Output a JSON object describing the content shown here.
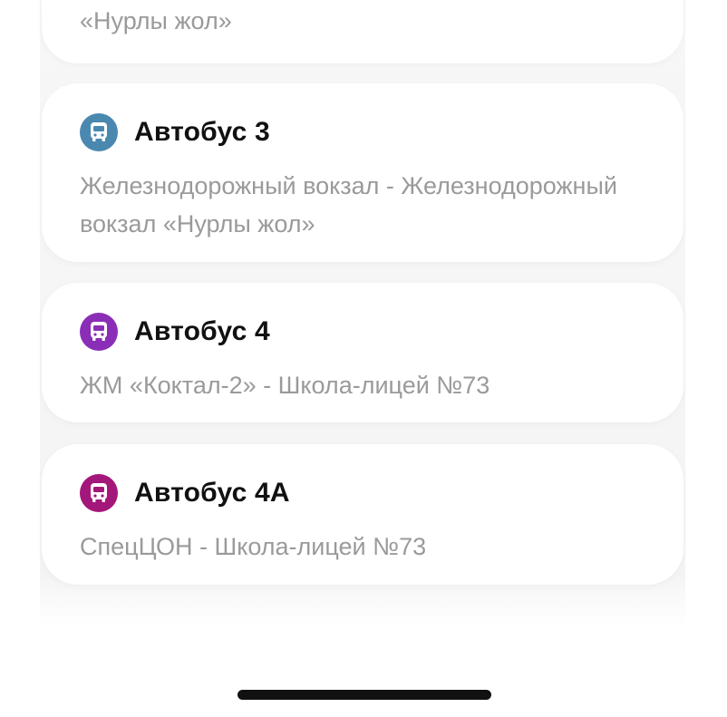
{
  "routes": [
    {
      "route": "«Нурлы жол»"
    },
    {
      "title": "Автобус 3",
      "route": "Железнодорожный вокзал - Железнодорожный вокзал «Нурлы жол»",
      "color": "#4a88b0",
      "icon": "bus-icon"
    },
    {
      "title": "Автобус 4",
      "route": "ЖМ «Коктал-2» - Школа-лицей №73",
      "color": "#8a2eb8",
      "icon": "bus-icon"
    },
    {
      "title": "Автобус 4А",
      "route": "СпецЦОН - Школа-лицей №73",
      "color": "#a4177a",
      "icon": "bus-icon"
    }
  ]
}
